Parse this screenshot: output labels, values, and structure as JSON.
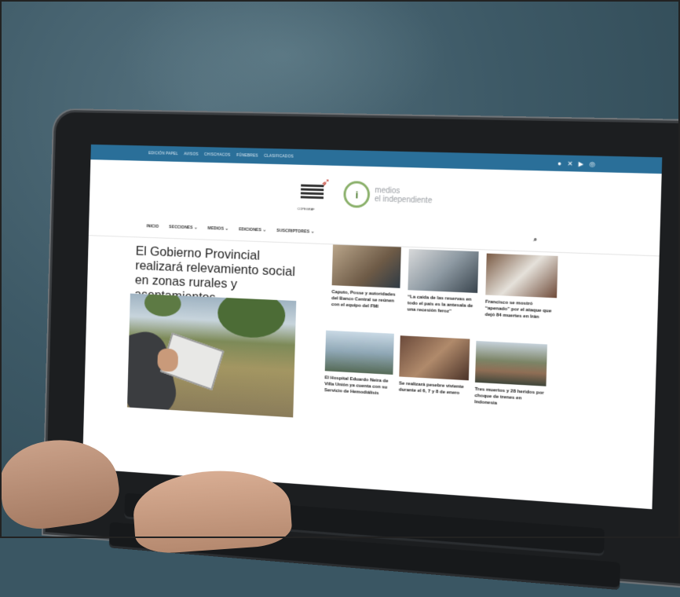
{
  "topbar": {
    "links": [
      "EDICIÓN PAPEL",
      "AVISOS",
      "CHISCHACOS",
      "FÚNEBRES",
      "CLASIFICADOS"
    ],
    "social_icons": [
      "facebook-icon",
      "x-icon",
      "youtube-icon",
      "instagram-icon"
    ]
  },
  "logos": {
    "coop_caption": "COPEGRAF",
    "brand_line1": "medios",
    "brand_line2": "el independiente"
  },
  "nav": {
    "items": [
      "INICIO",
      "SECCIONES ⌄",
      "MEDIOS ⌄",
      "EDICIONES ⌄",
      "SUSCRIPTORES ⌄"
    ]
  },
  "main_story": {
    "headline": "El Gobierno Provincial realizará relevamiento social en zonas rurales y asentamientos"
  },
  "cards": [
    {
      "title": "Caputo, Posse y autoridades del Banco Central se reúnen con el equipo del FMI"
    },
    {
      "title": "“La caída de las reservas en todo el país es la antesala de una recesión feroz”"
    },
    {
      "title": "Francisco se mostró “apenado” por el ataque que dejó 84 muertes en Irán"
    },
    {
      "title": "El Hospital Eduardo Neira de Villa Unión ya cuenta con su Servicio de Hemodiálisis"
    },
    {
      "title": "Se realizará pesebre viviente durante el 6, 7 y 8 de enero"
    },
    {
      "title": "Tres muertos y 28 heridos por choque de trenes en Indonesia"
    }
  ],
  "colors": {
    "background": "#3a5663",
    "topbar": "#2a6f99",
    "brand_green": "#8ab06a"
  }
}
